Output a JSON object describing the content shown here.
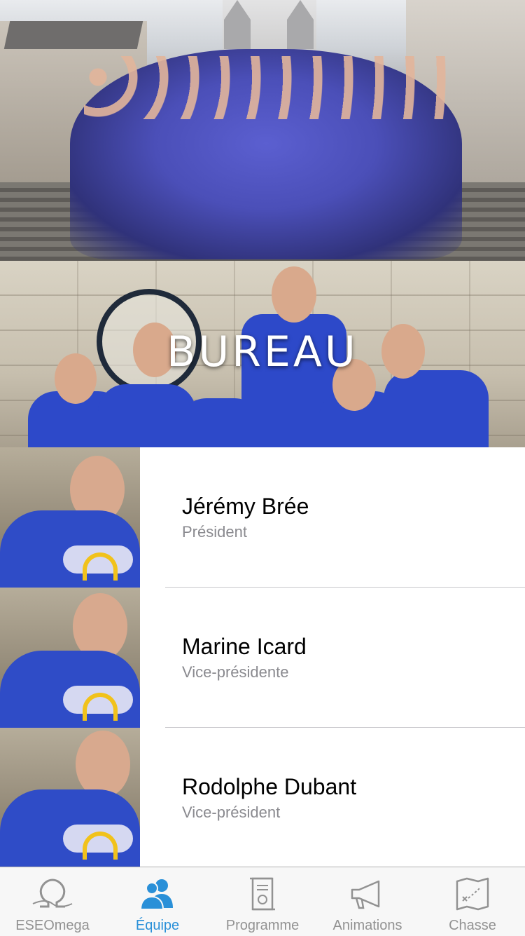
{
  "banner": {
    "title": "BUREAU"
  },
  "members": [
    {
      "name": "Jérémy Brée",
      "role": "Président"
    },
    {
      "name": "Marine Icard",
      "role": "Vice-présidente"
    },
    {
      "name": "Rodolphe Dubant",
      "role": "Vice-président"
    }
  ],
  "tabs": [
    {
      "label": "ESEOmega",
      "icon": "omega-icon"
    },
    {
      "label": "Équipe",
      "icon": "team-icon",
      "active": true
    },
    {
      "label": "Programme",
      "icon": "scroll-icon"
    },
    {
      "label": "Animations",
      "icon": "megaphone-icon"
    },
    {
      "label": "Chasse",
      "icon": "treasure-map-icon"
    }
  ],
  "colors": {
    "accent": "#2a90d8",
    "inactive": "#929292",
    "shirt": "#2f4cc7"
  }
}
